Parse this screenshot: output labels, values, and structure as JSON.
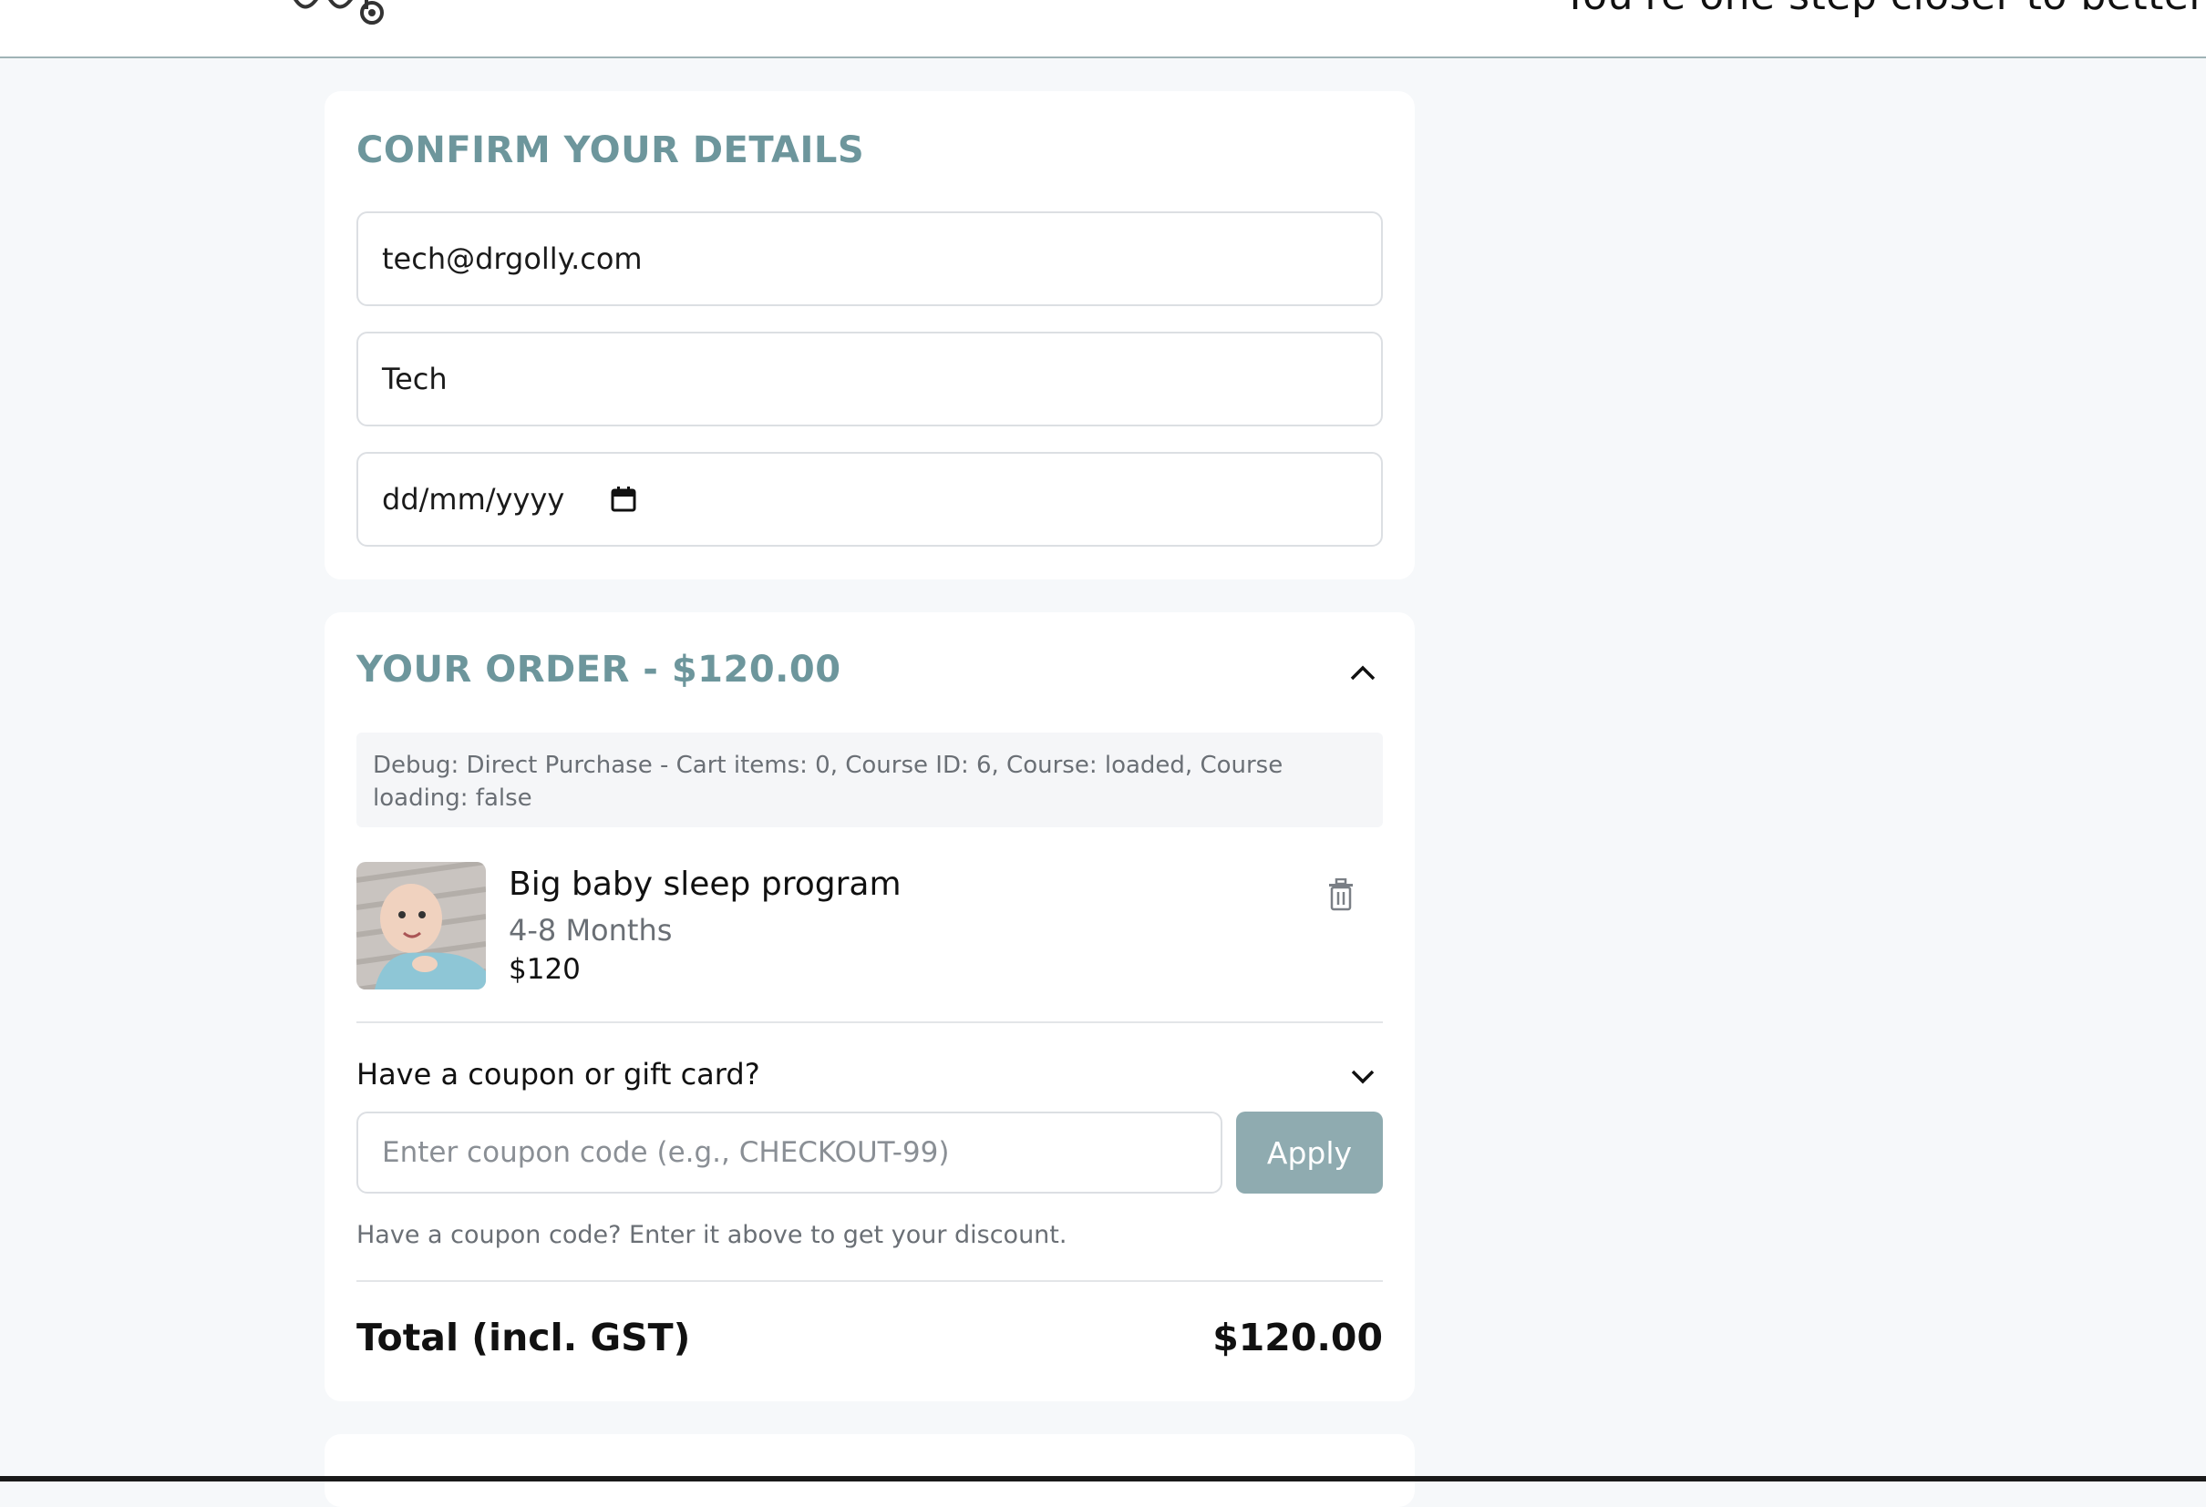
{
  "header": {
    "tagline": "You're one step closer to better"
  },
  "details": {
    "title": "CONFIRM YOUR DETAILS",
    "email": "tech@drgolly.com",
    "name": "Tech",
    "date_placeholder": "dd/mm/yyyy"
  },
  "order": {
    "title": "YOUR ORDER - $120.00",
    "debug": "Debug: Direct Purchase - Cart items: 0, Course ID: 6, Course: loaded, Course loading: false",
    "item": {
      "name": "Big baby sleep program",
      "age_range": "4-8 Months",
      "price": "$120"
    },
    "coupon": {
      "question": "Have a coupon or gift card?",
      "placeholder": "Enter coupon code (e.g., CHECKOUT-99)",
      "apply_label": "Apply",
      "hint": "Have a coupon code? Enter it above to get your discount."
    },
    "total_label": "Total (incl. GST)",
    "total_value": "$120.00"
  },
  "colors": {
    "accent": "#6d969c",
    "apply_button": "#8fabb0",
    "page_background": "#f6f8fa"
  },
  "icons": [
    "logo-icon",
    "calendar-icon",
    "chevron-up-icon",
    "trash-icon",
    "chevron-down-icon"
  ]
}
